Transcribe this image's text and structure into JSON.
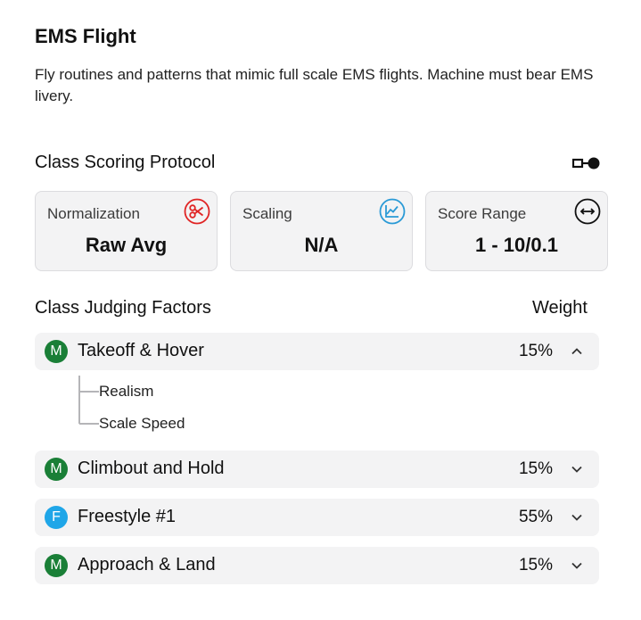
{
  "header": {
    "title": "EMS Flight",
    "description": "Fly routines and patterns that mimic full scale EMS flights. Machine must bear EMS livery."
  },
  "scoring": {
    "title": "Class Scoring Protocol",
    "cards": [
      {
        "label": "Normalization",
        "value": "Raw Avg",
        "icon": "scissors-icon",
        "color": "#e02424"
      },
      {
        "label": "Scaling",
        "value": "N/A",
        "icon": "line-chart-icon",
        "color": "#2a9ad6"
      },
      {
        "label": "Score Range",
        "value": "1 - 10/0.1",
        "icon": "horizontal-arrows-icon",
        "color": "#111111"
      }
    ]
  },
  "factors": {
    "title": "Class Judging Factors",
    "weight_header": "Weight",
    "items": [
      {
        "badge": "M",
        "badge_color": "#1a7f37",
        "label": "Takeoff & Hover",
        "weight": "15%",
        "expanded": true,
        "subitems": [
          "Realism",
          "Scale Speed"
        ]
      },
      {
        "badge": "M",
        "badge_color": "#1a7f37",
        "label": "Climbout and Hold",
        "weight": "15%",
        "expanded": false
      },
      {
        "badge": "F",
        "badge_color": "#1fa6e8",
        "label": "Freestyle #1",
        "weight": "55%",
        "expanded": false
      },
      {
        "badge": "M",
        "badge_color": "#1a7f37",
        "label": "Approach & Land",
        "weight": "15%",
        "expanded": false
      }
    ]
  }
}
